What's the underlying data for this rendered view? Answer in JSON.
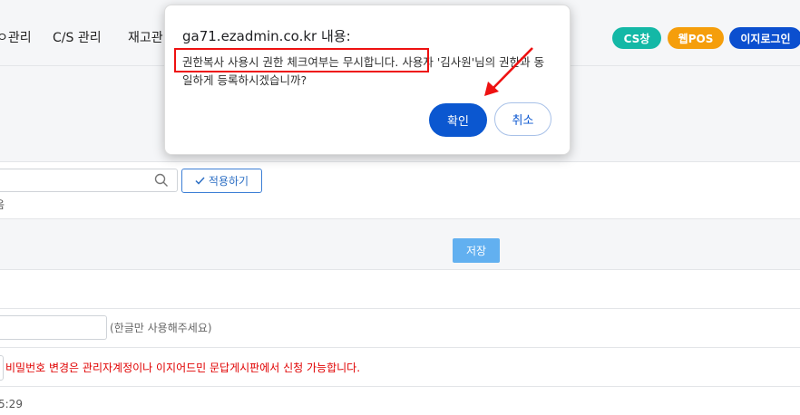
{
  "nav": {
    "items": [
      "ㅇ관리",
      "C/S 관리",
      "재고관"
    ],
    "buttons": [
      {
        "label": "CS창",
        "color": "#14b8a6"
      },
      {
        "label": "웹POS",
        "color": "#f59e0b"
      },
      {
        "label": "이지로그인",
        "color": "#0b4fcf"
      }
    ]
  },
  "search": {
    "apply_label": "적용하기",
    "partial_text": "음"
  },
  "save_label": "저장",
  "name_hint": "(한글만 사용해주세요)",
  "password_notice": "비밀번호 변경은 관리자계정이나 이지어드민 문답게시판에서 신청 가능합니다.",
  "time_partial": "5:29",
  "dialog": {
    "title": "ga71.ezadmin.co.kr 내용:",
    "message": "권한복사 사용시 권한 체크여부는 무시합니다. 사용자 '김사원'님의 권한과 동일하게 등록하시겠습니까?",
    "ok_label": "확인",
    "cancel_label": "취소"
  },
  "colors": {
    "annotation_red": "#e11111",
    "primary_blue": "#0b57d0",
    "notice_red": "#e00000"
  }
}
